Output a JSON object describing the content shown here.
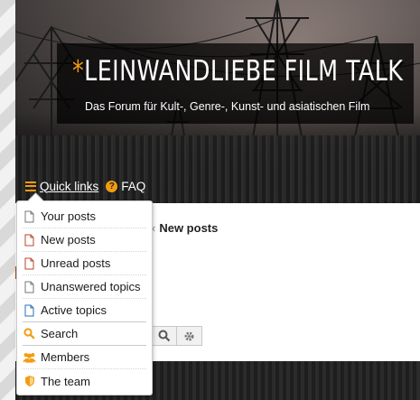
{
  "header": {
    "title_star": "*",
    "title": "LEINWANDLIEBE FILM TALK",
    "description": "Das Forum für Kult-, Genre-, Kunst- und asiatischen Film"
  },
  "navbar": {
    "quick_links_label": "Quick links",
    "faq_label": "FAQ",
    "menu_icon": "hamburger-icon",
    "faq_icon": "question-circle-icon"
  },
  "breadcrumb": {
    "separator": "‹",
    "current": "New posts"
  },
  "quick_links_menu": {
    "items": [
      {
        "label": "Your posts",
        "icon": "file-icon"
      },
      {
        "label": "New posts",
        "icon": "file-red-icon"
      },
      {
        "label": "Unread posts",
        "icon": "file-red-icon"
      },
      {
        "label": "Unanswered topics",
        "icon": "file-icon"
      },
      {
        "label": "Active topics",
        "icon": "file-blue-icon"
      },
      {
        "label": "Search",
        "icon": "search-icon"
      },
      {
        "label": "Members",
        "icon": "group-icon"
      },
      {
        "label": "The team",
        "icon": "shield-icon"
      }
    ]
  },
  "colors": {
    "accent": "#f39c12",
    "unread": "#b34a2a",
    "active": "#2a6fb3"
  }
}
